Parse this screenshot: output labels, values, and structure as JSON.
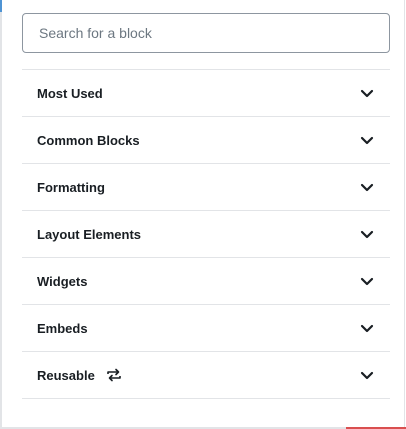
{
  "search": {
    "placeholder": "Search for a block",
    "value": ""
  },
  "categories": [
    {
      "label": "Most Used",
      "icon": "chevron-down-icon"
    },
    {
      "label": "Common Blocks",
      "icon": "chevron-down-icon"
    },
    {
      "label": "Formatting",
      "icon": "chevron-down-icon"
    },
    {
      "label": "Layout Elements",
      "icon": "chevron-down-icon"
    },
    {
      "label": "Widgets",
      "icon": "chevron-down-icon"
    },
    {
      "label": "Embeds",
      "icon": "chevron-down-icon"
    },
    {
      "label": "Reusable",
      "extra_icon": "reusable-block-icon",
      "icon": "chevron-down-icon"
    }
  ],
  "colors": {
    "text": "#191e23",
    "border": "#e2e4e7",
    "input_border": "#8d96a0",
    "placeholder": "#6c7781"
  }
}
